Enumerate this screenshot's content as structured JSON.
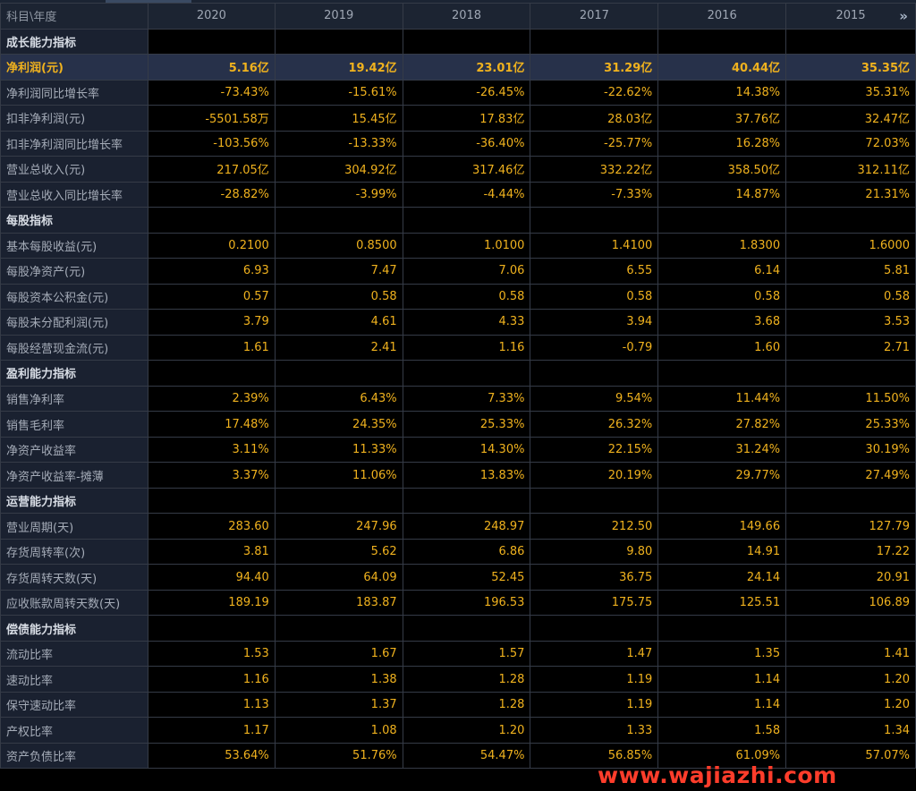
{
  "header": {
    "label": "科目\\年度",
    "years": [
      "2020",
      "2019",
      "2018",
      "2017",
      "2016",
      "2015"
    ],
    "more_glyph": "»"
  },
  "rows": [
    {
      "type": "section",
      "label": "成长能力指标"
    },
    {
      "type": "highlight",
      "label": "净利润(元)",
      "values": [
        "5.16亿",
        "19.42亿",
        "23.01亿",
        "31.29亿",
        "40.44亿",
        "35.35亿"
      ]
    },
    {
      "type": "data",
      "label": "净利润同比增长率",
      "values": [
        "-73.43%",
        "-15.61%",
        "-26.45%",
        "-22.62%",
        "14.38%",
        "35.31%"
      ]
    },
    {
      "type": "data",
      "label": "扣非净利润(元)",
      "values": [
        "-5501.58万",
        "15.45亿",
        "17.83亿",
        "28.03亿",
        "37.76亿",
        "32.47亿"
      ]
    },
    {
      "type": "data",
      "label": "扣非净利润同比增长率",
      "values": [
        "-103.56%",
        "-13.33%",
        "-36.40%",
        "-25.77%",
        "16.28%",
        "72.03%"
      ]
    },
    {
      "type": "data",
      "label": "营业总收入(元)",
      "values": [
        "217.05亿",
        "304.92亿",
        "317.46亿",
        "332.22亿",
        "358.50亿",
        "312.11亿"
      ]
    },
    {
      "type": "data",
      "label": "营业总收入同比增长率",
      "values": [
        "-28.82%",
        "-3.99%",
        "-4.44%",
        "-7.33%",
        "14.87%",
        "21.31%"
      ]
    },
    {
      "type": "section",
      "label": "每股指标"
    },
    {
      "type": "data",
      "label": "基本每股收益(元)",
      "values": [
        "0.2100",
        "0.8500",
        "1.0100",
        "1.4100",
        "1.8300",
        "1.6000"
      ]
    },
    {
      "type": "data",
      "label": "每股净资产(元)",
      "values": [
        "6.93",
        "7.47",
        "7.06",
        "6.55",
        "6.14",
        "5.81"
      ]
    },
    {
      "type": "data",
      "label": "每股资本公积金(元)",
      "values": [
        "0.57",
        "0.58",
        "0.58",
        "0.58",
        "0.58",
        "0.58"
      ]
    },
    {
      "type": "data",
      "label": "每股未分配利润(元)",
      "values": [
        "3.79",
        "4.61",
        "4.33",
        "3.94",
        "3.68",
        "3.53"
      ]
    },
    {
      "type": "data",
      "label": "每股经营现金流(元)",
      "values": [
        "1.61",
        "2.41",
        "1.16",
        "-0.79",
        "1.60",
        "2.71"
      ]
    },
    {
      "type": "section",
      "label": "盈利能力指标"
    },
    {
      "type": "data",
      "label": "销售净利率",
      "values": [
        "2.39%",
        "6.43%",
        "7.33%",
        "9.54%",
        "11.44%",
        "11.50%"
      ]
    },
    {
      "type": "data",
      "label": "销售毛利率",
      "values": [
        "17.48%",
        "24.35%",
        "25.33%",
        "26.32%",
        "27.82%",
        "25.33%"
      ]
    },
    {
      "type": "data",
      "label": "净资产收益率",
      "values": [
        "3.11%",
        "11.33%",
        "14.30%",
        "22.15%",
        "31.24%",
        "30.19%"
      ]
    },
    {
      "type": "data",
      "label": "净资产收益率-摊薄",
      "values": [
        "3.37%",
        "11.06%",
        "13.83%",
        "20.19%",
        "29.77%",
        "27.49%"
      ]
    },
    {
      "type": "section",
      "label": "运营能力指标"
    },
    {
      "type": "data",
      "label": "营业周期(天)",
      "values": [
        "283.60",
        "247.96",
        "248.97",
        "212.50",
        "149.66",
        "127.79"
      ]
    },
    {
      "type": "data",
      "label": "存货周转率(次)",
      "values": [
        "3.81",
        "5.62",
        "6.86",
        "9.80",
        "14.91",
        "17.22"
      ]
    },
    {
      "type": "data",
      "label": "存货周转天数(天)",
      "values": [
        "94.40",
        "64.09",
        "52.45",
        "36.75",
        "24.14",
        "20.91"
      ]
    },
    {
      "type": "data",
      "label": "应收账款周转天数(天)",
      "values": [
        "189.19",
        "183.87",
        "196.53",
        "175.75",
        "125.51",
        "106.89"
      ]
    },
    {
      "type": "section",
      "label": "偿债能力指标"
    },
    {
      "type": "data",
      "label": "流动比率",
      "values": [
        "1.53",
        "1.67",
        "1.57",
        "1.47",
        "1.35",
        "1.41"
      ]
    },
    {
      "type": "data",
      "label": "速动比率",
      "values": [
        "1.16",
        "1.38",
        "1.28",
        "1.19",
        "1.14",
        "1.20"
      ]
    },
    {
      "type": "data",
      "label": "保守速动比率",
      "values": [
        "1.13",
        "1.37",
        "1.28",
        "1.19",
        "1.14",
        "1.20"
      ]
    },
    {
      "type": "data",
      "label": "产权比率",
      "values": [
        "1.17",
        "1.08",
        "1.20",
        "1.33",
        "1.58",
        "1.34"
      ]
    },
    {
      "type": "data",
      "label": "资产负债比率",
      "values": [
        "53.64%",
        "51.76%",
        "54.47%",
        "56.85%",
        "61.09%",
        "57.07%"
      ]
    }
  ],
  "watermark": "www.wajiazhi.com",
  "colors": {
    "value": "#f0b21e",
    "watermark": "#ff3d2b",
    "label_bg": "#1a2130",
    "highlight_bg": "#27314a"
  }
}
